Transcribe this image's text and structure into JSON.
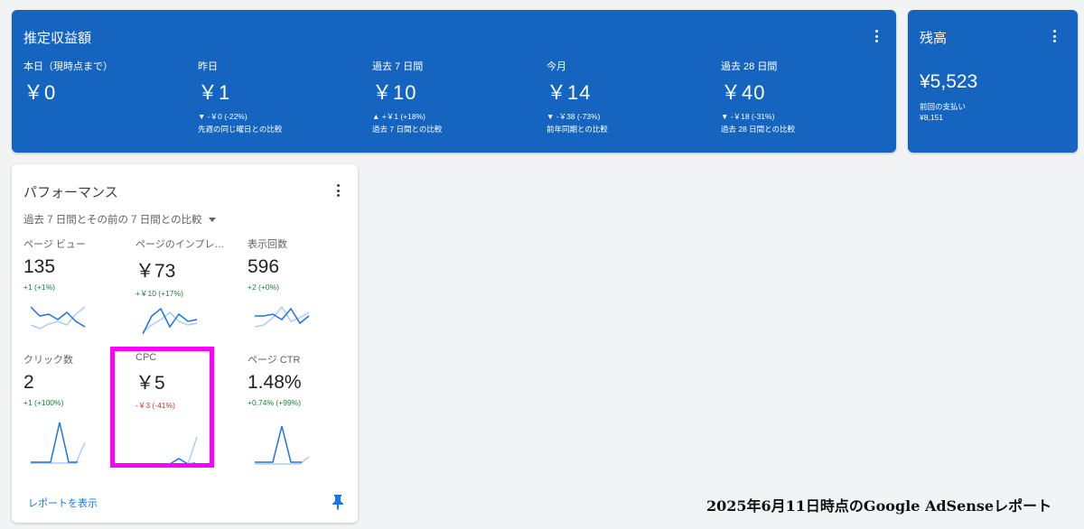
{
  "earnings": {
    "title": "推定収益額",
    "metrics": [
      {
        "label": "本日（現時点まで）",
        "value": "￥0",
        "change": "",
        "compare": ""
      },
      {
        "label": "昨日",
        "value": "￥1",
        "change": "▼ -￥0 (-22%)",
        "compare": "先週の同じ曜日との比較"
      },
      {
        "label": "過去 7 日間",
        "value": "￥10",
        "change": "▲ +￥1 (+18%)",
        "compare": "過去 7 日間との比較"
      },
      {
        "label": "今月",
        "value": "￥14",
        "change": "▼ -￥38 (-73%)",
        "compare": "前年同期との比較"
      },
      {
        "label": "過去 28 日間",
        "value": "￥40",
        "change": "▼ -￥18 (-31%)",
        "compare": "過去 28 日間との比較"
      }
    ]
  },
  "balance": {
    "title": "残高",
    "value": "¥5,523",
    "last_payment_label": "前回の支払い",
    "last_payment_value": "¥8,151"
  },
  "performance": {
    "title": "パフォーマンス",
    "period": "過去 7 日間とその前の 7 日間との比較",
    "metrics": [
      {
        "label": "ページ ビュー",
        "value": "135",
        "change": "+1 (+1%)",
        "trend": "positive"
      },
      {
        "label": "ページのインプレ…",
        "value": "￥73",
        "change": "+￥10 (+17%)",
        "trend": "positive"
      },
      {
        "label": "表示回数",
        "value": "596",
        "change": "+2 (+0%)",
        "trend": "positive"
      },
      {
        "label": "クリック数",
        "value": "2",
        "change": "+1 (+100%)",
        "trend": "positive"
      },
      {
        "label": "CPC",
        "value": "￥5",
        "change": "-￥3 (-41%)",
        "trend": "negative"
      },
      {
        "label": "ページ CTR",
        "value": "1.48%",
        "change": "+0.74% (+99%)",
        "trend": "positive"
      }
    ],
    "report_link": "レポートを表示"
  },
  "caption": "2025年6月11日時点のGoogle AdSenseレポート",
  "colors": {
    "card_blue": "#1565c0",
    "highlight": "#ff00ff",
    "line_current": "#1a73e8",
    "line_previous": "#aecbfa",
    "positive": "#188038",
    "negative": "#d93025"
  }
}
